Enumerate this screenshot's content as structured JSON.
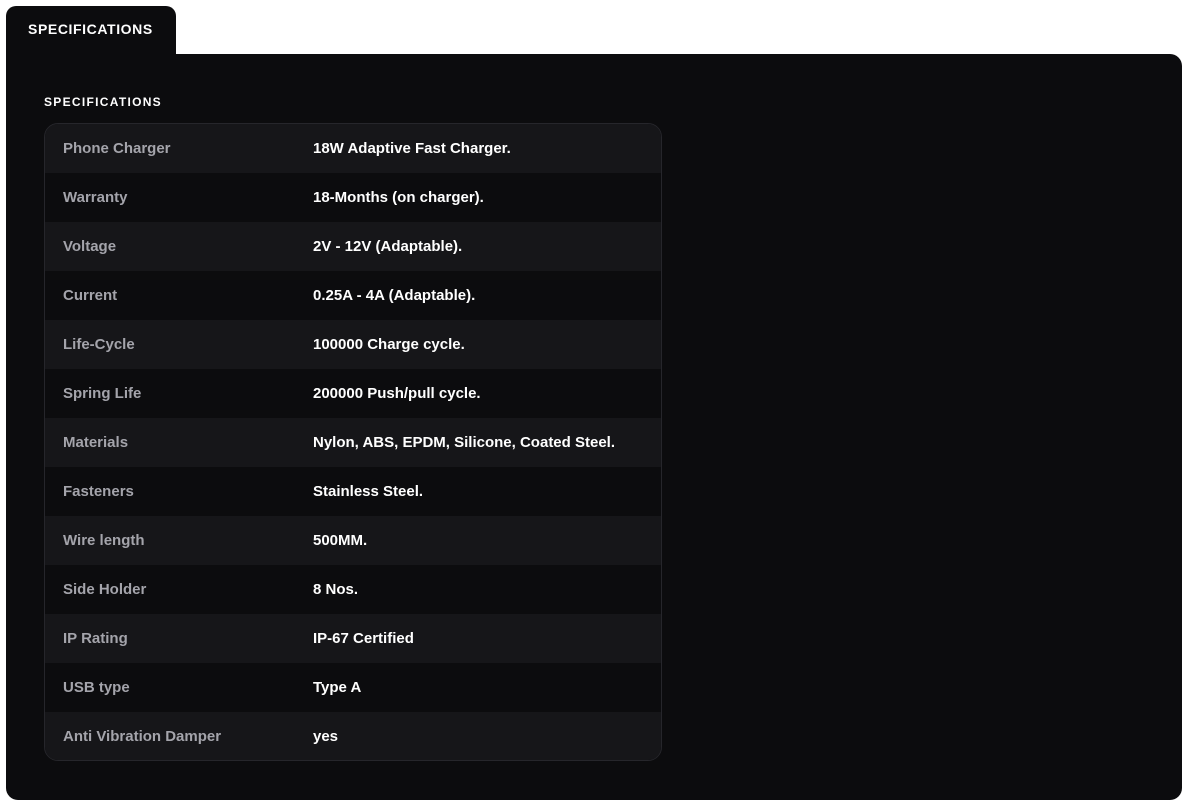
{
  "tab": {
    "label": "SPECIFICATIONS"
  },
  "panel": {
    "title": "SPECIFICATIONS"
  },
  "specs": [
    {
      "label": "Phone Charger",
      "value": "18W Adaptive Fast Charger."
    },
    {
      "label": "Warranty",
      "value": "18-Months (on charger)."
    },
    {
      "label": "Voltage",
      "value": "2V - 12V (Adaptable)."
    },
    {
      "label": "Current",
      "value": "0.25A - 4A (Adaptable)."
    },
    {
      "label": "Life-Cycle",
      "value": "100000 Charge cycle."
    },
    {
      "label": "Spring Life",
      "value": "200000 Push/pull cycle."
    },
    {
      "label": "Materials",
      "value": "Nylon, ABS, EPDM, Silicone, Coated Steel."
    },
    {
      "label": "Fasteners",
      "value": "Stainless Steel."
    },
    {
      "label": "Wire length",
      "value": "500MM."
    },
    {
      "label": "Side Holder",
      "value": "8 Nos."
    },
    {
      "label": "IP Rating",
      "value": "IP-67 Certified"
    },
    {
      "label": "USB type",
      "value": "Type A"
    },
    {
      "label": "Anti Vibration Damper",
      "value": "yes"
    }
  ]
}
